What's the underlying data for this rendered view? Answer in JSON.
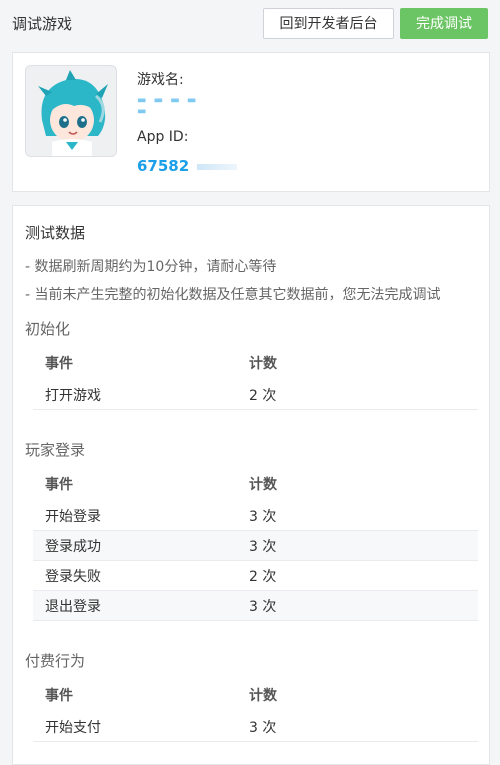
{
  "header": {
    "title": "调试游戏",
    "back_button": "回到开发者后台",
    "finish_button": "完成调试"
  },
  "game": {
    "name_label": "游戏名:",
    "app_id_label": "App ID:",
    "app_id_value": "67582"
  },
  "data": {
    "title": "测试数据",
    "notes": [
      "- 数据刷新周期约为10分钟，请耐心等待",
      "- 当前未产生完整的初始化数据及任意其它数据前，您无法完成调试"
    ],
    "columns": {
      "event": "事件",
      "count": "计数"
    },
    "sections": [
      {
        "title": "初始化",
        "rows": [
          {
            "event": "打开游戏",
            "count": "2 次"
          }
        ]
      },
      {
        "title": "玩家登录",
        "rows": [
          {
            "event": "开始登录",
            "count": "3 次"
          },
          {
            "event": "登录成功",
            "count": "3 次"
          },
          {
            "event": "登录失败",
            "count": "2 次"
          },
          {
            "event": "退出登录",
            "count": "3 次"
          }
        ]
      },
      {
        "title": "付费行为",
        "rows": [
          {
            "event": "开始支付",
            "count": "3 次"
          }
        ]
      }
    ]
  },
  "colors": {
    "primary": "#6cc564",
    "link": "#1a9fe8"
  }
}
